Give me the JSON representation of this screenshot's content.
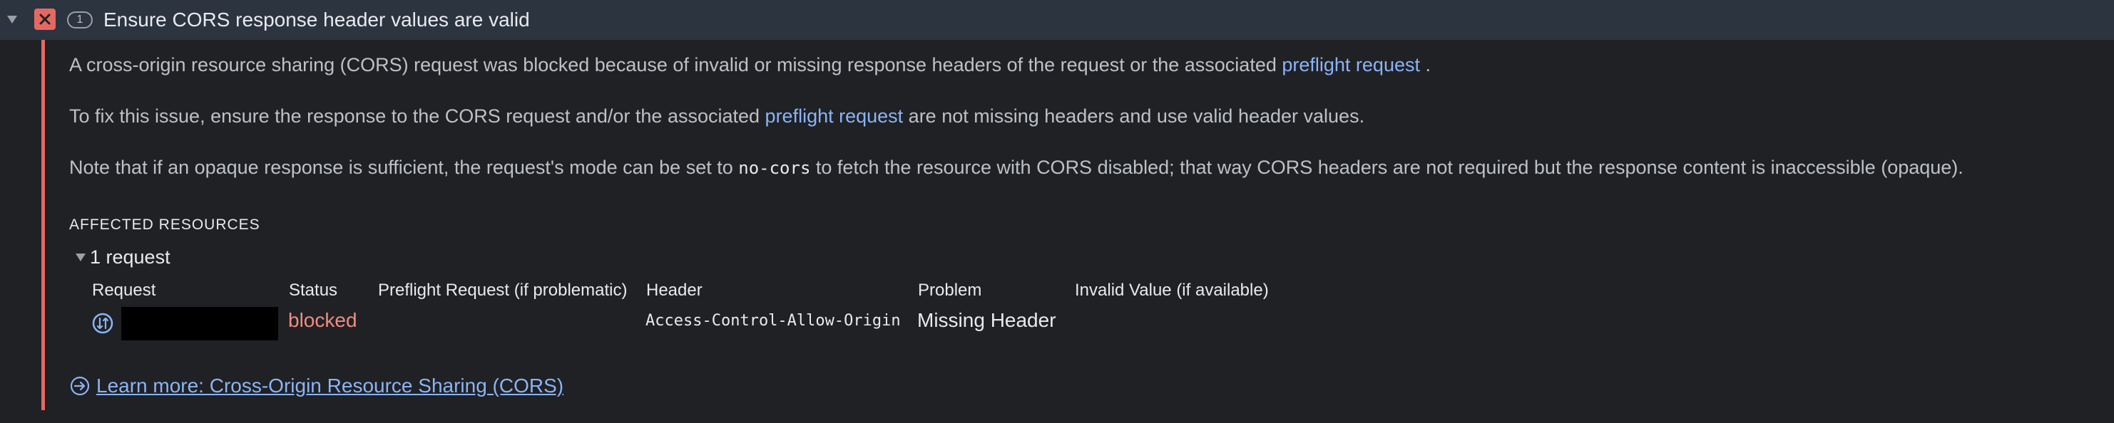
{
  "issue": {
    "count": "1",
    "title": "Ensure CORS response header values are valid"
  },
  "description": {
    "p1_text": "A cross-origin resource sharing (CORS) request was blocked because of invalid or missing response headers of the request or the associated ",
    "p1_link": "preflight request",
    "p1_end": " .",
    "p2_text": "To fix this issue, ensure the response to the CORS request and/or the associated ",
    "p2_link": "preflight request",
    "p2_end": " are not missing headers and use valid header values.",
    "p3_text": "Note that if an opaque response is sufficient, the request's mode can be set to ",
    "p3_code": "no-cors",
    "p3_end": " to fetch the resource with CORS disabled; that way CORS headers are not required but the response content is inaccessible (opaque)."
  },
  "affected": {
    "heading": "AFFECTED RESOURCES",
    "toggle_label": "1 request",
    "columns": {
      "request": "Request",
      "status": "Status",
      "preflight": "Preflight Request (if problematic)",
      "header": "Header",
      "problem": "Problem",
      "invalid_value": "Invalid Value (if available)"
    },
    "rows": [
      {
        "request": "",
        "status": "blocked",
        "preflight": "",
        "header": "Access-Control-Allow-Origin",
        "problem": "Missing Header",
        "invalid_value": ""
      }
    ]
  },
  "learn_more": {
    "label": "Learn more: Cross-Origin Resource Sharing (CORS)"
  },
  "icons": {
    "expand": "chevron-down-icon",
    "error": "error-flag-icon",
    "network": "network-request-icon",
    "learn_more": "arrow-circle-right-icon"
  },
  "colors": {
    "background": "#202124",
    "header_bg": "#2c3440",
    "error": "#e46962",
    "link": "#8ab4f8",
    "status_blocked": "#f28b82"
  }
}
